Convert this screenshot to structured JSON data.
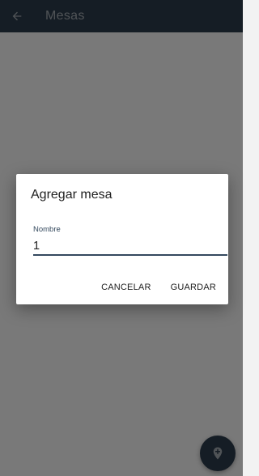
{
  "appbar": {
    "title": "Mesas",
    "back_icon": "arrow-back-icon",
    "background": "#2b3a4a"
  },
  "fab": {
    "icon": "add-location-icon",
    "background": "#2b3a4a"
  },
  "dialog": {
    "title": "Agregar mesa",
    "field": {
      "label": "Nombre",
      "value": "1"
    },
    "buttons": {
      "cancel": "CANCELAR",
      "save": "GUARDAR"
    }
  }
}
